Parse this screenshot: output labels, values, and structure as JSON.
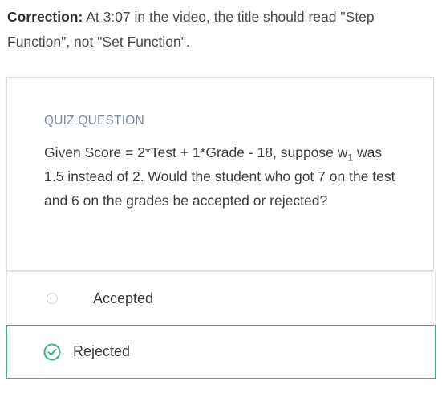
{
  "correction": {
    "label": "Correction:",
    "text": " At 3:07 in the video, the title should read \"Step Function\", not \"Set Function\"."
  },
  "quiz": {
    "heading": "QUIZ QUESTION",
    "question_before_sub": "Given Score = 2*Test + 1*Grade - 18, suppose w",
    "question_sub": "1",
    "question_after_sub": " was 1.5 instead of 2. Would the student who got 7 on the test and 6 on the grades be accepted or rejected?",
    "options": [
      {
        "label": "Accepted",
        "selected": false
      },
      {
        "label": "Rejected",
        "selected": true
      }
    ]
  },
  "colors": {
    "correct_green": "#3fb37a",
    "heading_gray": "#7b8a99"
  },
  "icons": {
    "radio": "radio-unselected-icon",
    "check": "check-circle-icon"
  }
}
